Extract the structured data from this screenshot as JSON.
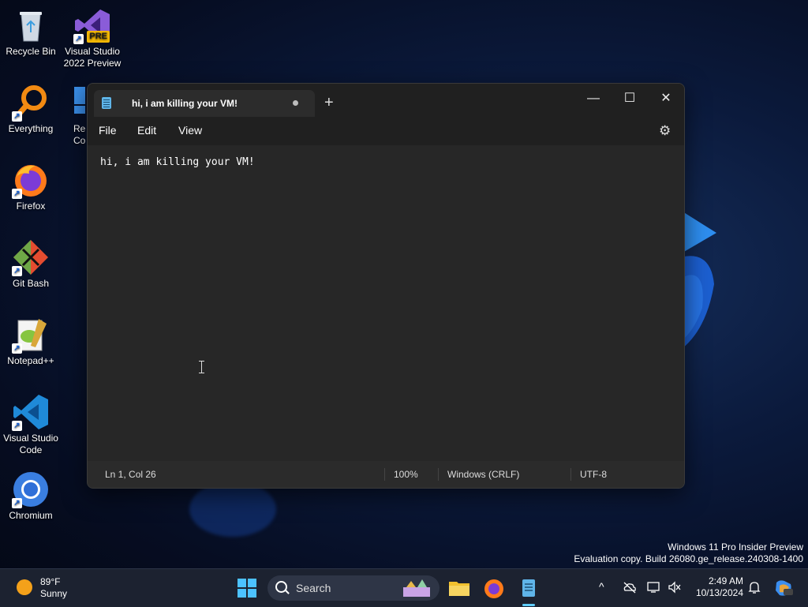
{
  "desktop": {
    "icons": [
      {
        "label": "Recycle Bin",
        "icon": "recycle-bin-icon"
      },
      {
        "label": "Visual Studio 2022 Preview",
        "icon": "visual-studio-icon",
        "badge": "PRE"
      },
      {
        "label": "Everything",
        "icon": "everything-search-icon"
      },
      {
        "label": "Rec Co",
        "icon": "recycle-config-icon"
      },
      {
        "label": "Firefox",
        "icon": "firefox-icon"
      },
      {
        "label": "Git Bash",
        "icon": "git-bash-icon"
      },
      {
        "label": "Notepad++",
        "icon": "notepadpp-icon"
      },
      {
        "label": "Visual Studio Code",
        "icon": "vscode-icon"
      },
      {
        "label": "Chromium",
        "icon": "chromium-icon"
      }
    ],
    "watermark": {
      "line1": "Windows 11 Pro Insider Preview",
      "line2": "Evaluation copy. Build 26080.ge_release.240308-1400"
    }
  },
  "notepad": {
    "tab_title": "hi, i am killing your VM!",
    "new_tab": "+",
    "window_controls": {
      "minimize": "—",
      "maximize": "☐",
      "close": "✕"
    },
    "menu": [
      "File",
      "Edit",
      "View"
    ],
    "content": "hi, i am killing your VM!",
    "status": {
      "position": "Ln 1, Col 26",
      "zoom": "100%",
      "line_ending": "Windows (CRLF)",
      "encoding": "UTF-8"
    }
  },
  "taskbar": {
    "weather": {
      "temp": "89°F",
      "condition": "Sunny"
    },
    "search_placeholder": "Search",
    "clock": {
      "time": "2:49 AM",
      "date": "10/13/2024"
    },
    "tray_chevron": "^"
  },
  "colors": {
    "accent": "#60cdff",
    "window_bg": "#272727",
    "titlebar_bg": "#202020",
    "taskbar_bg": "#1c2230"
  }
}
